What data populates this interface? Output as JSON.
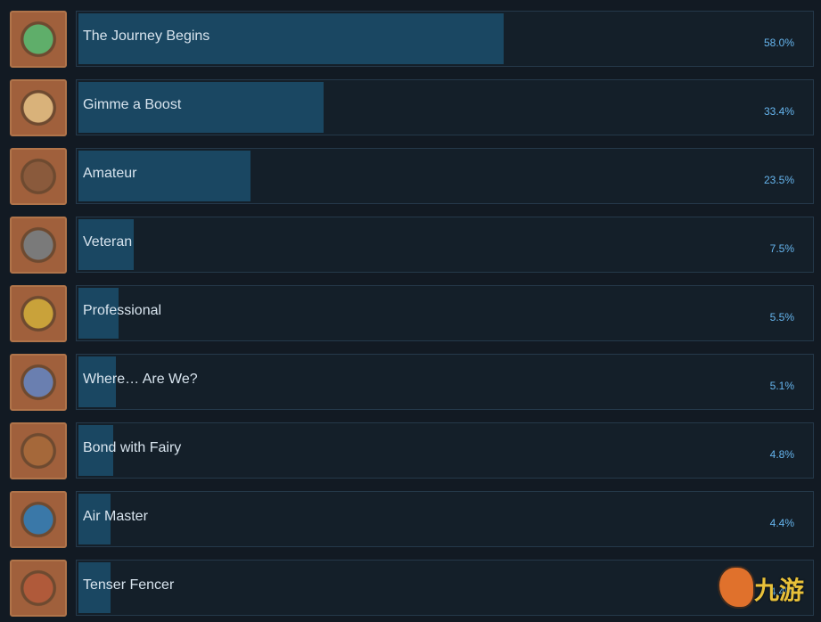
{
  "achievements": [
    {
      "name": "The Journey Begins",
      "percent": "58.0%",
      "value": 58.0,
      "icon": "journey-badge-icon",
      "color": "#5fae6a"
    },
    {
      "name": "Gimme a Boost",
      "percent": "33.4%",
      "value": 33.4,
      "icon": "sword-boost-badge-icon",
      "color": "#d9b27a"
    },
    {
      "name": "Amateur",
      "percent": "23.5%",
      "value": 23.5,
      "icon": "battle-50-badge-icon",
      "color": "#8a5a3c"
    },
    {
      "name": "Veteran",
      "percent": "7.5%",
      "value": 7.5,
      "icon": "battle-200-badge-icon",
      "color": "#7a7a7a"
    },
    {
      "name": "Professional",
      "percent": "5.5%",
      "value": 5.5,
      "icon": "battle-500-badge-icon",
      "color": "#c9a23a"
    },
    {
      "name": "Where… Are We?",
      "percent": "5.1%",
      "value": 5.1,
      "icon": "landscape-badge-icon",
      "color": "#6a7fb0"
    },
    {
      "name": "Bond with Fairy",
      "percent": "4.8%",
      "value": 4.8,
      "icon": "level-10-badge-icon",
      "color": "#a5683a"
    },
    {
      "name": "Air Master",
      "percent": "4.4%",
      "value": 4.4,
      "icon": "air-master-badge-icon",
      "color": "#3a78a8"
    },
    {
      "name": "Tenser Fencer",
      "percent": "4.4%",
      "value": 4.4,
      "icon": "high-tension-fencer-badge-icon",
      "color": "#b05a3a"
    }
  ],
  "watermark": {
    "text": "九游"
  }
}
